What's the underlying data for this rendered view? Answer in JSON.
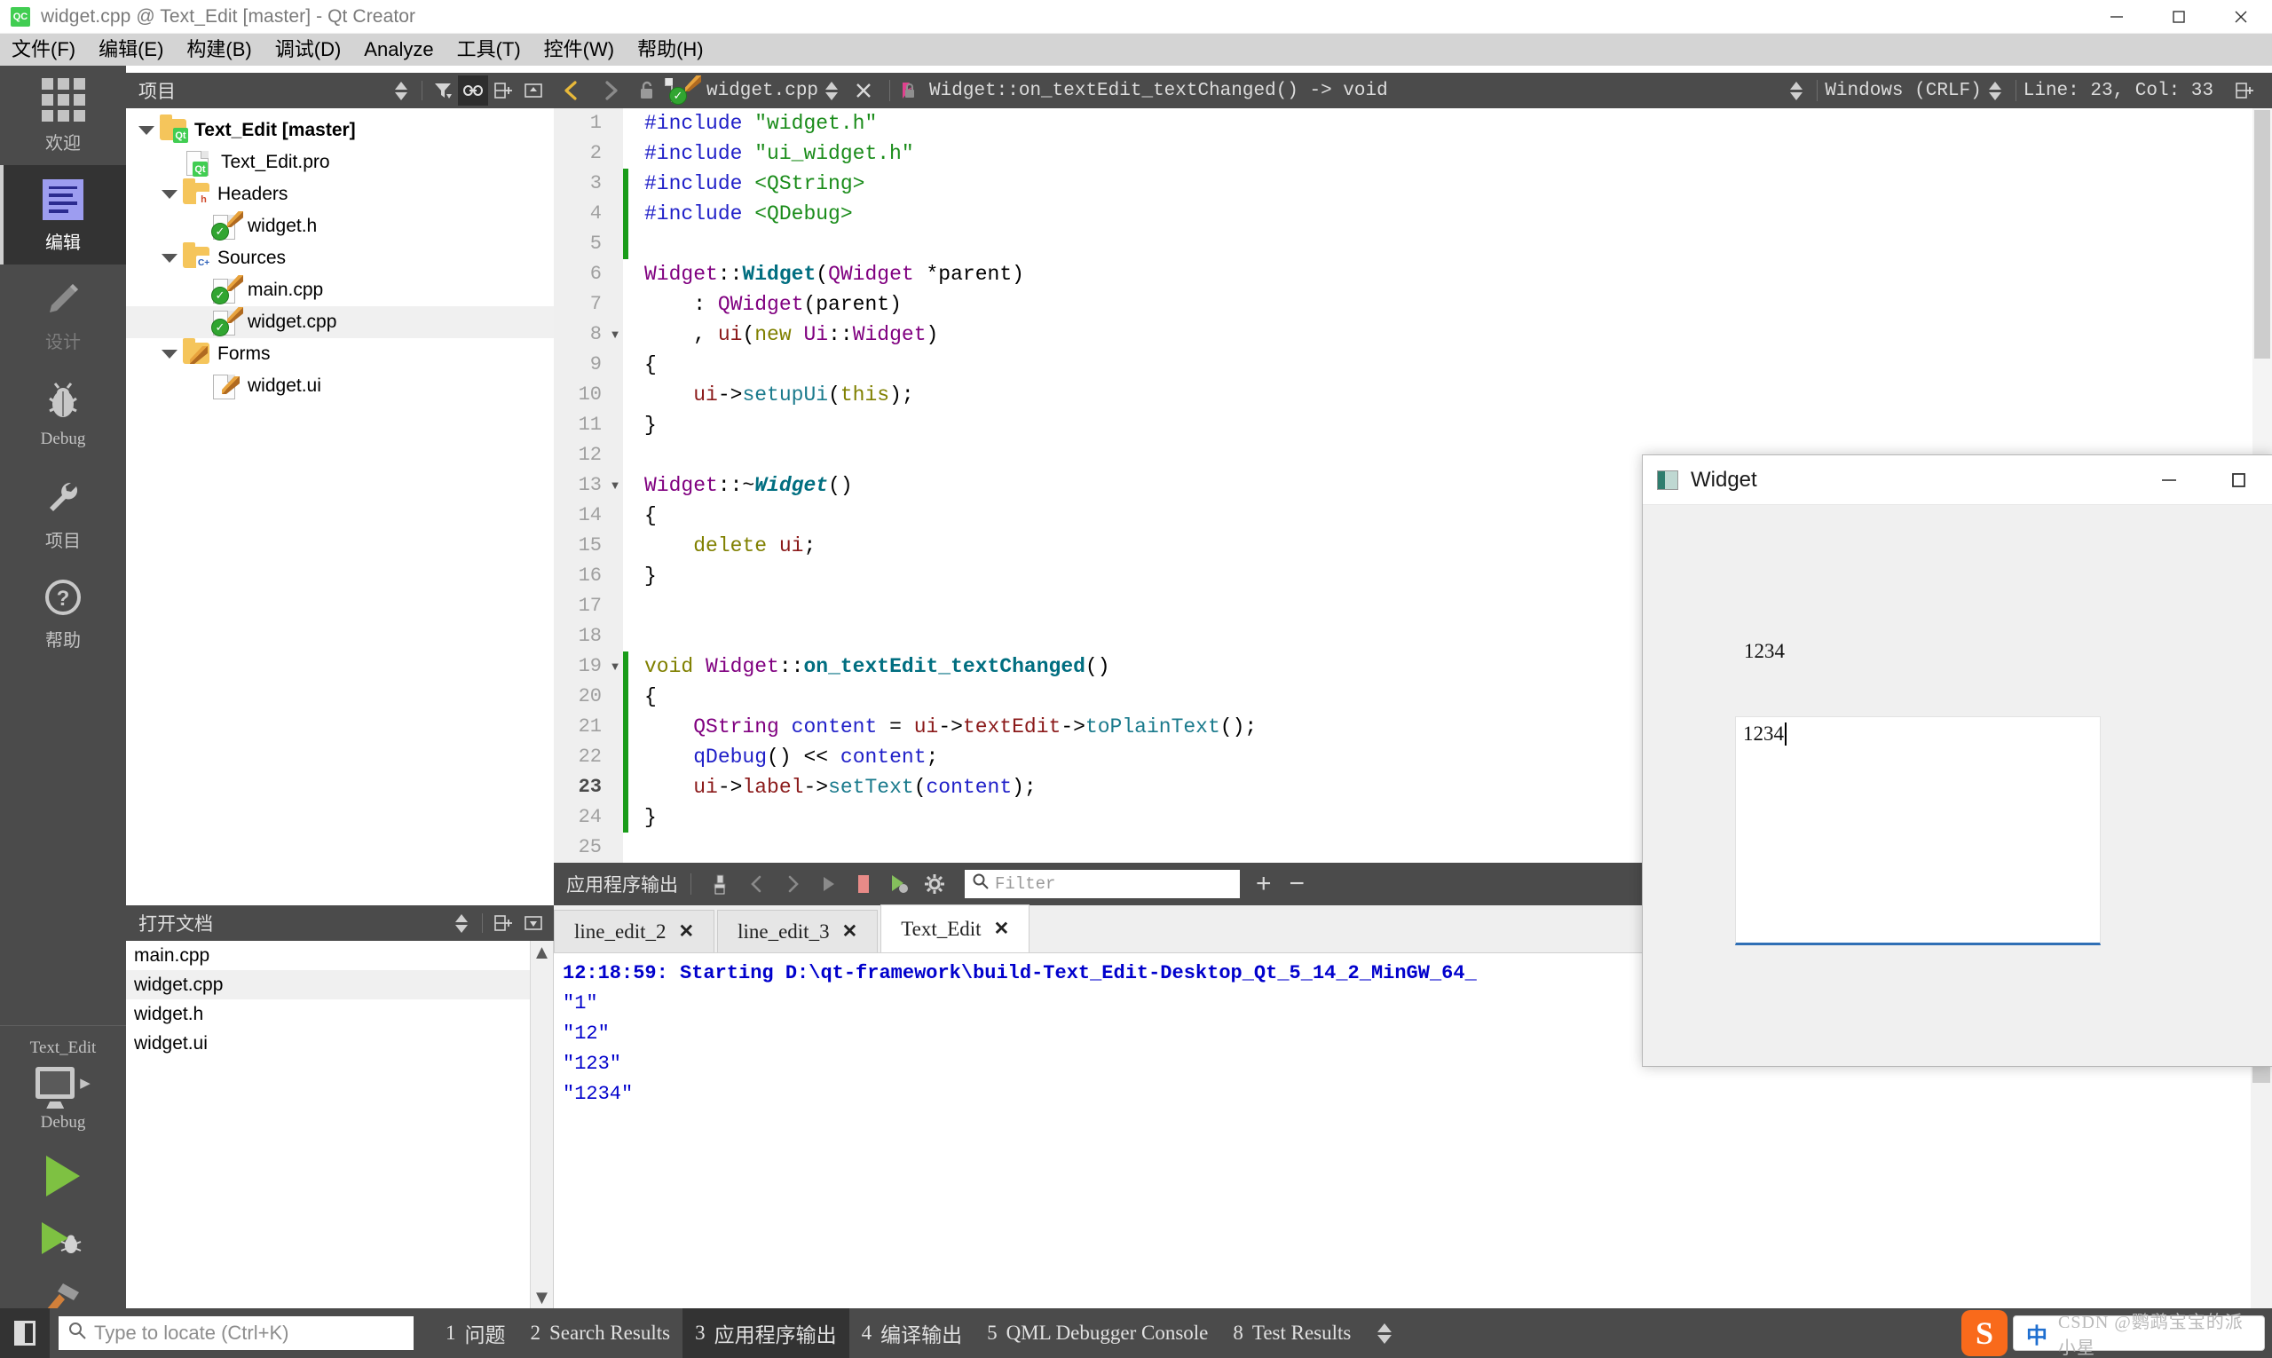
{
  "window": {
    "title": "widget.cpp @ Text_Edit [master] - Qt Creator",
    "app_badge": "QC",
    "minimize": "−",
    "maximize": "□",
    "close": "✕"
  },
  "menubar": [
    {
      "label": "文件(F)",
      "mnemonic": "F"
    },
    {
      "label": "编辑(E)",
      "mnemonic": "E"
    },
    {
      "label": "构建(B)",
      "mnemonic": "B"
    },
    {
      "label": "调试(D)",
      "mnemonic": "D"
    },
    {
      "label": "Analyze",
      "mnemonic": "A"
    },
    {
      "label": "工具(T)",
      "mnemonic": "T"
    },
    {
      "label": "控件(W)",
      "mnemonic": "W"
    },
    {
      "label": "帮助(H)",
      "mnemonic": "H"
    }
  ],
  "modebar": {
    "items": [
      {
        "label": "欢迎",
        "icon": "grid-icon",
        "state": "normal"
      },
      {
        "label": "编辑",
        "icon": "edit-lines-icon",
        "state": "active"
      },
      {
        "label": "设计",
        "icon": "pencil-icon",
        "state": "disabled"
      },
      {
        "label": "Debug",
        "icon": "bug-icon",
        "state": "normal"
      },
      {
        "label": "项目",
        "icon": "wrench-icon",
        "state": "normal"
      },
      {
        "label": "帮助",
        "icon": "question-icon",
        "state": "normal"
      }
    ],
    "kit": {
      "project": "Text_Edit",
      "build_config": "Debug",
      "target_icon": "monitor-icon",
      "run_icon": "run-triangle-icon",
      "debug_icon": "debug-run-icon",
      "build_icon": "hammer-icon"
    }
  },
  "project_panel": {
    "title": "项目",
    "tools": [
      "sync-selector-icon",
      "filter-icon",
      "link-icon",
      "split-icon",
      "close-split-icon"
    ],
    "tree": [
      {
        "label": "Text_Edit [master]",
        "depth": 0,
        "icon": "qt-folder-icon",
        "expanded": true,
        "bold": true,
        "selected": false
      },
      {
        "label": "Text_Edit.pro",
        "depth": 1,
        "icon": "qt-pro-file-icon",
        "expanded": null,
        "bold": false,
        "selected": false
      },
      {
        "label": "Headers",
        "depth": 1,
        "icon": "h-folder-icon",
        "expanded": true,
        "bold": false,
        "selected": false
      },
      {
        "label": "widget.h",
        "depth": 2,
        "icon": "cpp-file-icon",
        "expanded": null,
        "bold": false,
        "selected": false
      },
      {
        "label": "Sources",
        "depth": 1,
        "icon": "cpp-folder-icon",
        "expanded": true,
        "bold": false,
        "selected": false
      },
      {
        "label": "main.cpp",
        "depth": 2,
        "icon": "cpp-file-icon",
        "expanded": null,
        "bold": false,
        "selected": false
      },
      {
        "label": "widget.cpp",
        "depth": 2,
        "icon": "cpp-file-icon",
        "expanded": null,
        "bold": false,
        "selected": true
      },
      {
        "label": "Forms",
        "depth": 1,
        "icon": "forms-folder-icon",
        "expanded": true,
        "bold": false,
        "selected": false
      },
      {
        "label": "widget.ui",
        "depth": 2,
        "icon": "ui-file-icon",
        "expanded": null,
        "bold": false,
        "selected": false
      }
    ]
  },
  "open_documents": {
    "title": "打开文档",
    "items": [
      {
        "label": "main.cpp",
        "selected": false
      },
      {
        "label": "widget.cpp",
        "selected": true
      },
      {
        "label": "widget.h",
        "selected": false
      },
      {
        "label": "widget.ui",
        "selected": false
      }
    ]
  },
  "editor_toolbar": {
    "back_icon": "back-arrow-icon",
    "forward_icon": "forward-arrow-icon",
    "lock_icon": "unlocked-icon",
    "file_icon": "cpp-file-icon",
    "filename": "widget.cpp",
    "close_icon": "close-icon",
    "symbol_icon": "function-icon",
    "symbol": "Widget::on_textEdit_textChanged() -> void",
    "line_ending": "Windows (CRLF)",
    "cursor_position": "Line: 23, Col: 33",
    "split_icon": "split-icon"
  },
  "code": {
    "current_line": 23,
    "lines": [
      {
        "n": 1,
        "fold": "",
        "change": false,
        "tokens": [
          {
            "t": "#include ",
            "c": "pre"
          },
          {
            "t": "\"widget.h\"",
            "c": "str"
          }
        ]
      },
      {
        "n": 2,
        "fold": "",
        "change": false,
        "tokens": [
          {
            "t": "#include ",
            "c": "pre"
          },
          {
            "t": "\"ui_widget.h\"",
            "c": "str"
          }
        ]
      },
      {
        "n": 3,
        "fold": "",
        "change": true,
        "tokens": [
          {
            "t": "#include ",
            "c": "pre"
          },
          {
            "t": "<QString>",
            "c": "str"
          }
        ]
      },
      {
        "n": 4,
        "fold": "",
        "change": true,
        "tokens": [
          {
            "t": "#include ",
            "c": "pre"
          },
          {
            "t": "<QDebug>",
            "c": "str"
          }
        ]
      },
      {
        "n": 5,
        "fold": "",
        "change": true,
        "tokens": []
      },
      {
        "n": 6,
        "fold": "",
        "change": false,
        "tokens": [
          {
            "t": "Widget",
            "c": "type"
          },
          {
            "t": "::",
            "c": "op"
          },
          {
            "t": "Widget",
            "c": "fn"
          },
          {
            "t": "(",
            "c": "op"
          },
          {
            "t": "QWidget",
            "c": "type"
          },
          {
            "t": " *parent)",
            "c": "op"
          }
        ]
      },
      {
        "n": 7,
        "fold": "",
        "change": false,
        "tokens": [
          {
            "t": "    : ",
            "c": "op"
          },
          {
            "t": "QWidget",
            "c": "type"
          },
          {
            "t": "(parent)",
            "c": "op"
          }
        ]
      },
      {
        "n": 8,
        "fold": "▼",
        "change": false,
        "tokens": [
          {
            "t": "    , ",
            "c": "op"
          },
          {
            "t": "ui",
            "c": "var"
          },
          {
            "t": "(",
            "c": "op"
          },
          {
            "t": "new",
            "c": "kw"
          },
          {
            "t": " Ui",
            "c": "type"
          },
          {
            "t": "::",
            "c": "op"
          },
          {
            "t": "Widget",
            "c": "type"
          },
          {
            "t": ")",
            "c": "op"
          }
        ]
      },
      {
        "n": 9,
        "fold": "",
        "change": false,
        "tokens": [
          {
            "t": "{",
            "c": "op"
          }
        ]
      },
      {
        "n": 10,
        "fold": "",
        "change": false,
        "tokens": [
          {
            "t": "    ",
            "c": "op"
          },
          {
            "t": "ui",
            "c": "var"
          },
          {
            "t": "->",
            "c": "op"
          },
          {
            "t": "setupUi",
            "c": "mem"
          },
          {
            "t": "(",
            "c": "op"
          },
          {
            "t": "this",
            "c": "kw"
          },
          {
            "t": ");",
            "c": "op"
          }
        ]
      },
      {
        "n": 11,
        "fold": "",
        "change": false,
        "tokens": [
          {
            "t": "}",
            "c": "op"
          }
        ]
      },
      {
        "n": 12,
        "fold": "",
        "change": false,
        "tokens": []
      },
      {
        "n": 13,
        "fold": "▼",
        "change": false,
        "tokens": [
          {
            "t": "Widget",
            "c": "type"
          },
          {
            "t": "::~",
            "c": "op"
          },
          {
            "t": "Widget",
            "c": "fni"
          },
          {
            "t": "()",
            "c": "op"
          }
        ]
      },
      {
        "n": 14,
        "fold": "",
        "change": false,
        "tokens": [
          {
            "t": "{",
            "c": "op"
          }
        ]
      },
      {
        "n": 15,
        "fold": "",
        "change": false,
        "tokens": [
          {
            "t": "    ",
            "c": "op"
          },
          {
            "t": "delete",
            "c": "kw"
          },
          {
            "t": " ",
            "c": "op"
          },
          {
            "t": "ui",
            "c": "var"
          },
          {
            "t": ";",
            "c": "op"
          }
        ]
      },
      {
        "n": 16,
        "fold": "",
        "change": false,
        "tokens": [
          {
            "t": "}",
            "c": "op"
          }
        ]
      },
      {
        "n": 17,
        "fold": "",
        "change": false,
        "tokens": []
      },
      {
        "n": 18,
        "fold": "",
        "change": false,
        "tokens": []
      },
      {
        "n": 19,
        "fold": "▼",
        "change": true,
        "tokens": [
          {
            "t": "void",
            "c": "kw"
          },
          {
            "t": " ",
            "c": "op"
          },
          {
            "t": "Widget",
            "c": "type"
          },
          {
            "t": "::",
            "c": "op"
          },
          {
            "t": "on_textEdit_textChanged",
            "c": "fn"
          },
          {
            "t": "()",
            "c": "op"
          }
        ]
      },
      {
        "n": 20,
        "fold": "",
        "change": true,
        "tokens": [
          {
            "t": "{",
            "c": "op"
          }
        ]
      },
      {
        "n": 21,
        "fold": "",
        "change": true,
        "tokens": [
          {
            "t": "    ",
            "c": "op"
          },
          {
            "t": "QString",
            "c": "type"
          },
          {
            "t": " ",
            "c": "op"
          },
          {
            "t": "content",
            "c": "blue"
          },
          {
            "t": " = ",
            "c": "op"
          },
          {
            "t": "ui",
            "c": "var"
          },
          {
            "t": "->",
            "c": "op"
          },
          {
            "t": "textEdit",
            "c": "var"
          },
          {
            "t": "->",
            "c": "op"
          },
          {
            "t": "toPlainText",
            "c": "mem"
          },
          {
            "t": "();",
            "c": "op"
          }
        ]
      },
      {
        "n": 22,
        "fold": "",
        "change": true,
        "tokens": [
          {
            "t": "    ",
            "c": "op"
          },
          {
            "t": "qDebug",
            "c": "blue"
          },
          {
            "t": "() ",
            "c": "op"
          },
          {
            "t": "<<",
            "c": "op"
          },
          {
            "t": " ",
            "c": "op"
          },
          {
            "t": "content",
            "c": "blue"
          },
          {
            "t": ";",
            "c": "op"
          }
        ]
      },
      {
        "n": 23,
        "fold": "",
        "change": true,
        "tokens": [
          {
            "t": "    ",
            "c": "op"
          },
          {
            "t": "ui",
            "c": "var"
          },
          {
            "t": "->",
            "c": "op"
          },
          {
            "t": "label",
            "c": "var"
          },
          {
            "t": "->",
            "c": "op"
          },
          {
            "t": "setText",
            "c": "mem"
          },
          {
            "t": "(",
            "c": "op"
          },
          {
            "t": "content",
            "c": "blue"
          },
          {
            "t": ");",
            "c": "op"
          }
        ]
      },
      {
        "n": 24,
        "fold": "",
        "change": true,
        "tokens": [
          {
            "t": "}",
            "c": "op"
          }
        ]
      },
      {
        "n": 25,
        "fold": "",
        "change": false,
        "tokens": []
      }
    ]
  },
  "output_pane": {
    "title": "应用程序输出",
    "toolbar_icons": [
      "clear-output-icon",
      "prev-item-icon",
      "next-item-icon",
      "run-icon",
      "stop-icon",
      "debug-run-icon",
      "settings-gear-icon"
    ],
    "filter_placeholder": "Filter",
    "add_label": "+",
    "remove_label": "−",
    "tabs": [
      {
        "label": "line_edit_2",
        "active": false,
        "close": "✕"
      },
      {
        "label": "line_edit_3",
        "active": false,
        "close": "✕"
      },
      {
        "label": "Text_Edit",
        "active": true,
        "close": "✕"
      }
    ],
    "lines": [
      {
        "text": "12:18:59: Starting D:\\qt-framework\\build-Text_Edit-Desktop_Qt_5_14_2_MinGW_64_",
        "bold": true
      },
      {
        "text": "\"1\"",
        "bold": false
      },
      {
        "text": "\"12\"",
        "bold": false
      },
      {
        "text": "\"123\"",
        "bold": false
      },
      {
        "text": "\"1234\"",
        "bold": false
      }
    ]
  },
  "statusbar": {
    "toggle_icon": "toggle-sidebar-icon",
    "locator_placeholder": "Type to locate (Ctrl+K)",
    "search_icon": "search-icon",
    "items": [
      {
        "num": "1",
        "label": "问题",
        "active": false
      },
      {
        "num": "2",
        "label": "Search Results",
        "active": false
      },
      {
        "num": "3",
        "label": "应用程序输出",
        "active": true
      },
      {
        "num": "4",
        "label": "编译输出",
        "active": false
      },
      {
        "num": "5",
        "label": "QML Debugger Console",
        "active": false
      },
      {
        "num": "8",
        "label": "Test Results",
        "active": false
      }
    ]
  },
  "tray": {
    "ime_logo": "S",
    "ime_mode": "中",
    "watermark": "CSDN @鹦鹉宝宝的派小星"
  },
  "widget_dialog": {
    "title": "Widget",
    "icon": "widget-app-icon",
    "minimize": "−",
    "maximize": "□",
    "label_text": "1234",
    "textedit_value": "1234"
  },
  "colors": {
    "accent_green": "#41cd52",
    "dark_panel": "#4b4b4b",
    "mode_active": "#333333",
    "output_blue": "#0000cc",
    "focus_underline": "#2f6fb5",
    "change_marker": "#1a9c1a"
  }
}
